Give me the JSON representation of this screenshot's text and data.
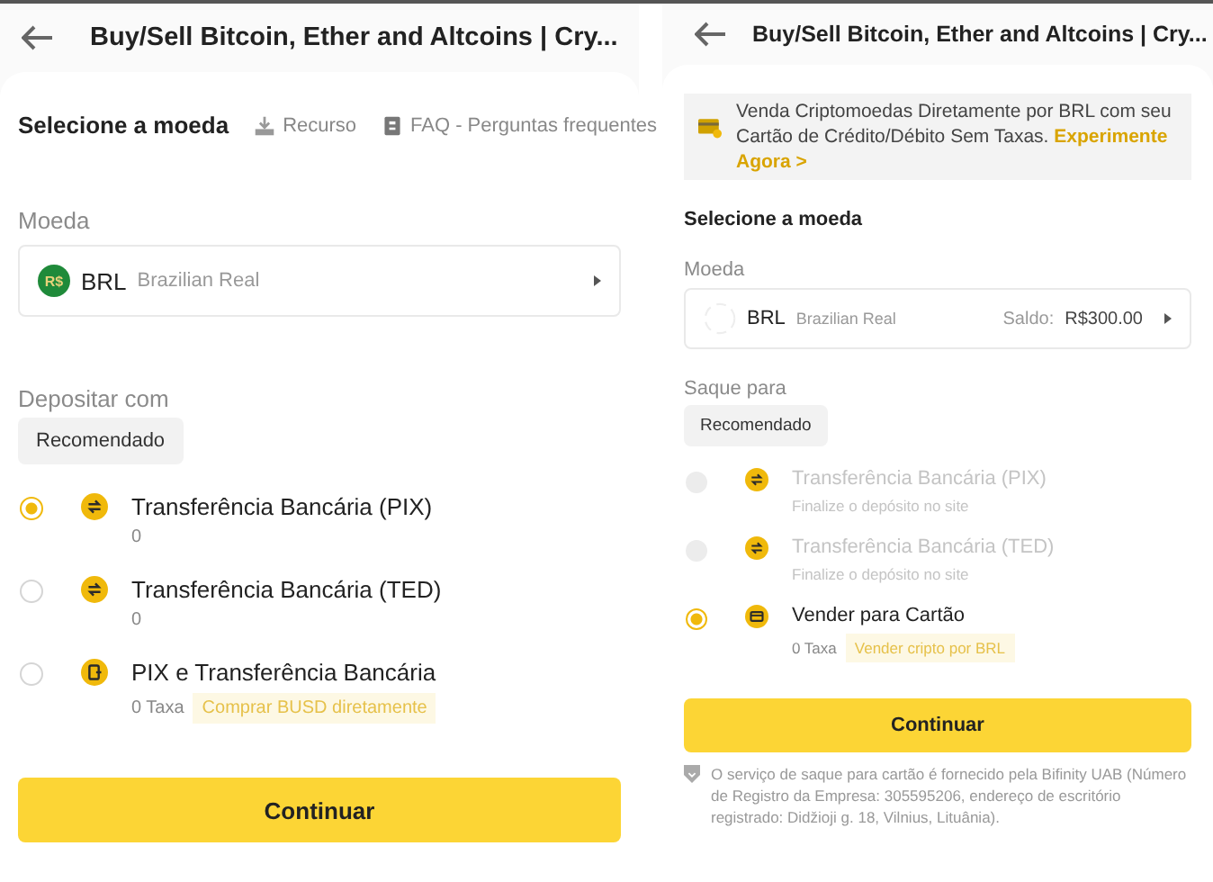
{
  "screens": [
    {
      "title": "Buy/Sell Bitcoin, Ether and Altcoins | Cry...",
      "heading": "Selecione a moeda",
      "links": [
        {
          "kind": "resource",
          "label": "Recurso"
        },
        {
          "kind": "faq",
          "label": "FAQ - Perguntas frequentes"
        }
      ],
      "currency_label": "Moeda",
      "currency": {
        "icon_text": "R$",
        "code": "BRL",
        "name": "Brazilian Real"
      },
      "method_label": "Depositar com",
      "chip": "Recomendado",
      "methods": [
        {
          "kind": "transfer",
          "name": "Transferência Bancária (PIX)",
          "detail": "0",
          "selected": true,
          "disabled": false
        },
        {
          "kind": "transfer",
          "name": "Transferência Bancária (TED)",
          "detail": "0",
          "selected": false,
          "disabled": false
        },
        {
          "kind": "pix",
          "name": "PIX e Transferência Bancária",
          "detail": "0 Taxa",
          "tag": "Comprar BUSD diretamente",
          "selected": false,
          "disabled": false
        }
      ],
      "button": "Continuar"
    },
    {
      "title": "Buy/Sell Bitcoin, Ether and Altcoins | Cry...",
      "banner": "Venda Criptomoedas Diretamente por BRL com seu Cartão de Crédito/Débito Sem Taxas. **Experimente Agora >**",
      "heading": "Selecione a moeda",
      "currency_label": "Moeda",
      "currency": {
        "code": "BRL",
        "name": "Brazilian Real",
        "balance_label": "Saldo:",
        "balance": "R$300.00"
      },
      "method_label": "Saque para",
      "chip": "Recomendado",
      "methods": [
        {
          "kind": "transfer",
          "name": "Transferência Bancária (PIX)",
          "detail": "Finalize o depósito no site",
          "selected": false,
          "disabled": true
        },
        {
          "kind": "transfer",
          "name": "Transferência Bancária (TED)",
          "detail": "Finalize o depósito no site",
          "selected": false,
          "disabled": true
        },
        {
          "kind": "card",
          "name": "Vender para Cartão",
          "detail": "0 Taxa",
          "tag": "Vender cripto por BRL",
          "selected": true,
          "disabled": false
        }
      ],
      "button": "Continuar",
      "note": "O serviço de saque para cartão é fornecido pela Bifinity UAB (Número de Registro da Empresa: 305595206, endereço de escritório registrado: Didžioji g. 18, Vilnius, Lituânia)."
    }
  ]
}
